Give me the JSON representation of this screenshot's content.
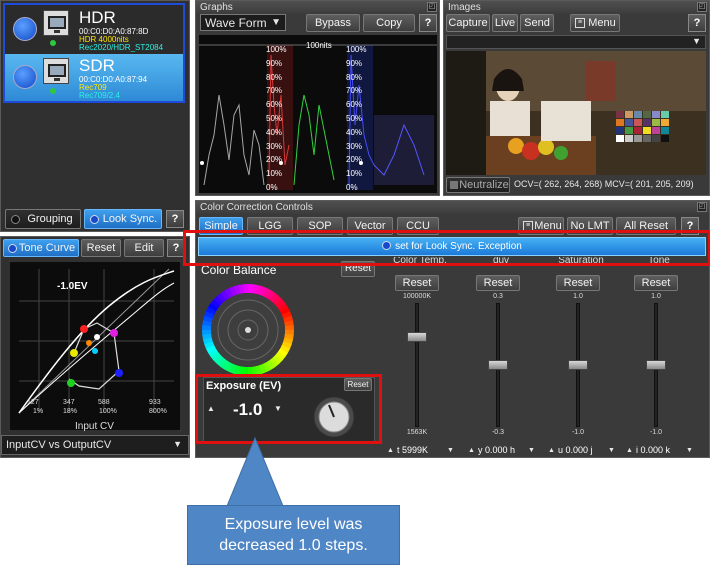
{
  "devices": [
    {
      "name": "HDR",
      "mac": "00:C0:D0:A0:87:8D",
      "line2": "HDR 4000nits",
      "line3": "Rec2020/HDR_ST2084",
      "selected": false
    },
    {
      "name": "SDR",
      "mac": "00:C0:D0:A0:87:94",
      "line2": "Rec709",
      "line3": "Rec709/2.4",
      "selected": true
    }
  ],
  "device_tabs": {
    "grouping": "Grouping",
    "look_sync": "Look Sync.",
    "help": "?"
  },
  "tone_curve": {
    "tab": "Tone Curve",
    "reset": "Reset",
    "edit": "Edit",
    "help": "?",
    "ev_label": "-1.0EV",
    "x_axis_label": "Input CV",
    "top_ticks": [
      "347",
      "588",
      "933"
    ],
    "bottom_ticks": [
      "1%",
      "18%",
      "100%",
      "800%"
    ],
    "corner_tick": "127",
    "dropdown": "InputCV vs OutputCV"
  },
  "graphs": {
    "title": "Graphs",
    "mode": "Wave Form",
    "bypass": "Bypass",
    "copy": "Copy",
    "help": "?",
    "nits_label": "100nits",
    "scale": [
      "100%",
      "90%",
      "80%",
      "70%",
      "60%",
      "50%",
      "40%",
      "30%",
      "20%",
      "10%",
      "0%"
    ]
  },
  "images": {
    "title": "Images",
    "capture": "Capture",
    "live": "Live",
    "send": "Send",
    "menu": "Menu",
    "help": "?",
    "neutralize": "Neutralize",
    "ocv_text": "OCV=( 262, 264, 268) MCV=( 201, 205, 209)"
  },
  "ccc": {
    "title": "Color Correction Controls",
    "tabs": [
      "Simple",
      "LGG",
      "SOP",
      "Vector",
      "CCU"
    ],
    "menu": "Menu",
    "no_lmt": "No LMT",
    "all_reset": "All Reset",
    "help": "?",
    "look_sync_bar": "set for Look Sync. Exception",
    "color_balance": "Color Balance",
    "color_balance_reset": "Reset",
    "exposure_title": "Exposure (EV)",
    "exposure_reset": "Reset",
    "exposure_value": "-1.0",
    "sliders": [
      {
        "label": "Color Temp.",
        "reset": "Reset",
        "top": "100000K",
        "bottom": "1563K",
        "value": "t 5999K",
        "level": 0.75
      },
      {
        "label": "duv",
        "reset": "Reset",
        "top": "0.3",
        "bottom": "-0.3",
        "value": "y 0.000 h",
        "level": 0.5
      },
      {
        "label": "Saturation",
        "reset": "Reset",
        "top": "1.0",
        "bottom": "-1.0",
        "value": "u 0.000 j",
        "level": 0.5
      },
      {
        "label": "Tone",
        "reset": "Reset",
        "top": "1.0",
        "bottom": "-1.0",
        "value": "i 0.000 k",
        "level": 0.5
      }
    ]
  },
  "callout": {
    "text": "Exposure level was decreased 1.0 steps."
  },
  "colors": {
    "accent_blue": "#2a8ae6",
    "highlight_red": "#e01010",
    "callout_fill": "#4f86c6"
  }
}
